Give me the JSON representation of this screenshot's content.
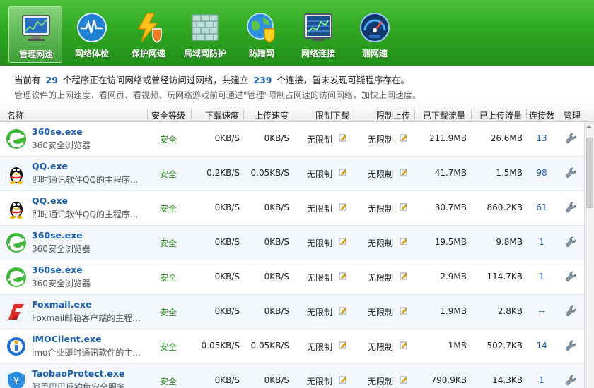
{
  "toolbar": {
    "items": [
      {
        "label": "管理网速",
        "icon": "monitor-chart-icon",
        "active": true
      },
      {
        "label": "网络体检",
        "icon": "heartbeat-icon"
      },
      {
        "label": "保护网速",
        "icon": "lightning-shield-icon"
      },
      {
        "label": "局域网防护",
        "icon": "firewall-icon"
      },
      {
        "label": "防蹭网",
        "icon": "globe-shield-icon"
      },
      {
        "label": "网络连接",
        "icon": "network-monitor-icon"
      },
      {
        "label": "测网速",
        "icon": "speedometer-icon"
      }
    ]
  },
  "info": {
    "line1_prefix": "当前有",
    "program_count": "29",
    "line1_mid": "个程序正在访问网络或曾经访问过网络，共建立",
    "connection_count": "239",
    "line1_suffix": "个连接，暂未发现可疑程序存在。",
    "line2": "管理软件的上网速度，看网页、看视频、玩网络游戏前可通过\"管理\"限制占网速的访问网络，加快上网速度。"
  },
  "table": {
    "headers": {
      "name": "名称",
      "security": "安全等级",
      "down_speed": "下载速度",
      "up_speed": "上传速度",
      "limit_down": "限制下载",
      "limit_up": "限制上传",
      "downloaded": "已下载流量",
      "uploaded": "已上传流量",
      "connections": "连接数",
      "manage": "管理"
    },
    "rows": [
      {
        "icon": "360se-icon",
        "name": "360se.exe",
        "desc": "360安全浏览器",
        "security": "安全",
        "down": "0KB/S",
        "up": "0KB/S",
        "limit_down": "无限制",
        "limit_up": "无限制",
        "downloaded": "211.9MB",
        "uploaded": "26.6MB",
        "connections": "13"
      },
      {
        "icon": "qq-icon",
        "name": "QQ.exe",
        "desc": "即时通讯软件QQ的主程序...",
        "security": "安全",
        "down": "0.2KB/S",
        "up": "0.05KB/S",
        "limit_down": "无限制",
        "limit_up": "无限制",
        "downloaded": "41.7MB",
        "uploaded": "1.5MB",
        "connections": "98"
      },
      {
        "icon": "qq-icon",
        "name": "QQ.exe",
        "desc": "即时通讯软件QQ的主程序...",
        "security": "安全",
        "down": "0KB/S",
        "up": "0KB/S",
        "limit_down": "无限制",
        "limit_up": "无限制",
        "downloaded": "30.7MB",
        "uploaded": "860.2KB",
        "connections": "61"
      },
      {
        "icon": "360se-icon",
        "name": "360se.exe",
        "desc": "360安全浏览器",
        "security": "安全",
        "down": "0KB/S",
        "up": "0KB/S",
        "limit_down": "无限制",
        "limit_up": "无限制",
        "downloaded": "19.5MB",
        "uploaded": "9.8MB",
        "connections": "1"
      },
      {
        "icon": "360se-icon",
        "name": "360se.exe",
        "desc": "360安全浏览器",
        "security": "安全",
        "down": "0KB/S",
        "up": "0KB/S",
        "limit_down": "无限制",
        "limit_up": "无限制",
        "downloaded": "2.9MB",
        "uploaded": "114.7KB",
        "connections": "1"
      },
      {
        "icon": "foxmail-icon",
        "name": "Foxmail.exe",
        "desc": "Foxmail邮箱客户端的主程...",
        "security": "安全",
        "down": "0KB/S",
        "up": "0KB/S",
        "limit_down": "无限制",
        "limit_up": "无限制",
        "downloaded": "1.9MB",
        "uploaded": "2.8KB",
        "connections": "--"
      },
      {
        "icon": "imoclient-icon",
        "name": "IMOClient.exe",
        "desc": "imo企业即时通讯软件的主...",
        "security": "安全",
        "down": "0.05KB/S",
        "up": "0.05KB/S",
        "limit_down": "无限制",
        "limit_up": "无限制",
        "downloaded": "1MB",
        "uploaded": "502.7KB",
        "connections": "14"
      },
      {
        "icon": "taobaoprotect-icon",
        "name": "TaobaoProtect.exe",
        "desc": "阿里巴巴反钓鱼安全服务",
        "security": "安全",
        "down": "0KB/S",
        "up": "0KB/S",
        "limit_down": "无限制",
        "limit_up": "无限制",
        "downloaded": "790.9KB",
        "uploaded": "14.3KB",
        "connections": "1"
      }
    ]
  },
  "colors": {
    "toolbar_green": "#2fa722",
    "link_blue": "#1a5fb4",
    "safe_green": "#2a8a1c"
  }
}
